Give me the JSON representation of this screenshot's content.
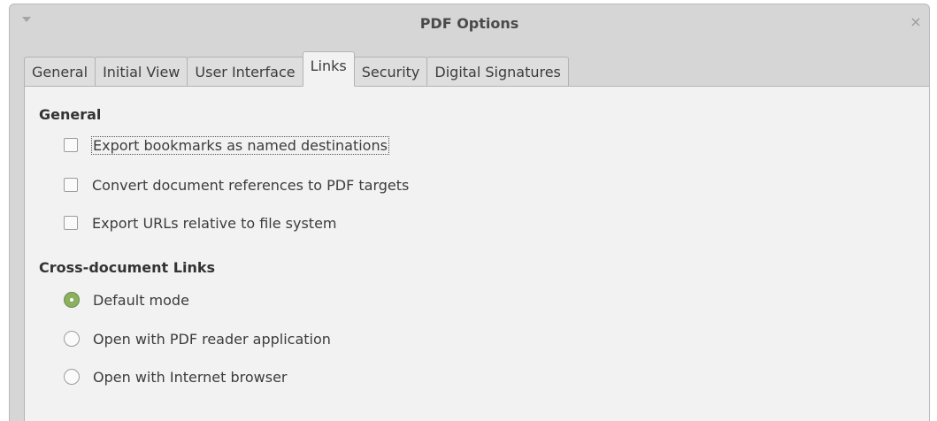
{
  "window": {
    "title": "PDF Options",
    "close_glyph": "×"
  },
  "tabs": [
    {
      "label": "General",
      "active": false
    },
    {
      "label": "Initial View",
      "active": false
    },
    {
      "label": "User Interface",
      "active": false
    },
    {
      "label": "Links",
      "active": true
    },
    {
      "label": "Security",
      "active": false
    },
    {
      "label": "Digital Signatures",
      "active": false
    }
  ],
  "general": {
    "title": "General",
    "options": [
      {
        "label": "Export bookmarks as named destinations",
        "checked": false,
        "focused": true
      },
      {
        "label": "Convert document references to PDF targets",
        "checked": false
      },
      {
        "label": "Export URLs relative to file system",
        "checked": false
      }
    ]
  },
  "cross_document": {
    "title": "Cross-document Links",
    "options": [
      {
        "label": "Default mode",
        "selected": true
      },
      {
        "label": "Open with PDF reader application",
        "selected": false
      },
      {
        "label": "Open with Internet browser",
        "selected": false
      }
    ]
  },
  "colors": {
    "radio_selected": "#8bb05f",
    "dialog_bg": "#d6d6d6",
    "panel_bg": "#f2f2f2"
  }
}
